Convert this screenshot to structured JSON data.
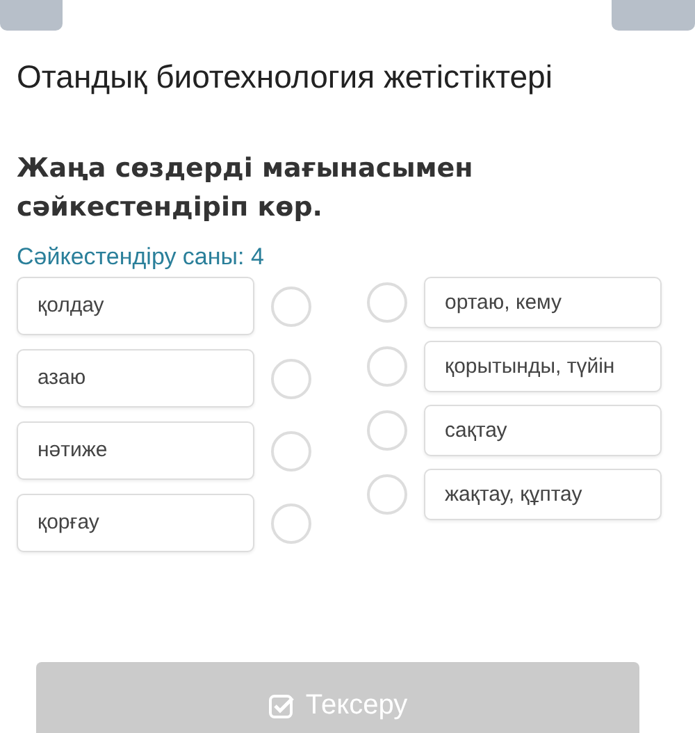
{
  "title": "Отандық биотехнология жетістіктері",
  "question": "Жаңа сөздерді мағынасымен сәйкестендіріп көр.",
  "match_count": "Сәйкестендіру саны: 4",
  "left_items": [
    {
      "label": "қолдау"
    },
    {
      "label": "азаю"
    },
    {
      "label": "нәтиже"
    },
    {
      "label": "қорғау"
    }
  ],
  "right_items": [
    {
      "label": "ортаю, кему"
    },
    {
      "label": "қорытынды, түйін"
    },
    {
      "label": "сақтау"
    },
    {
      "label": "жақтау, құптау"
    }
  ],
  "check_button": {
    "label": "Тексеру",
    "disabled": true
  }
}
